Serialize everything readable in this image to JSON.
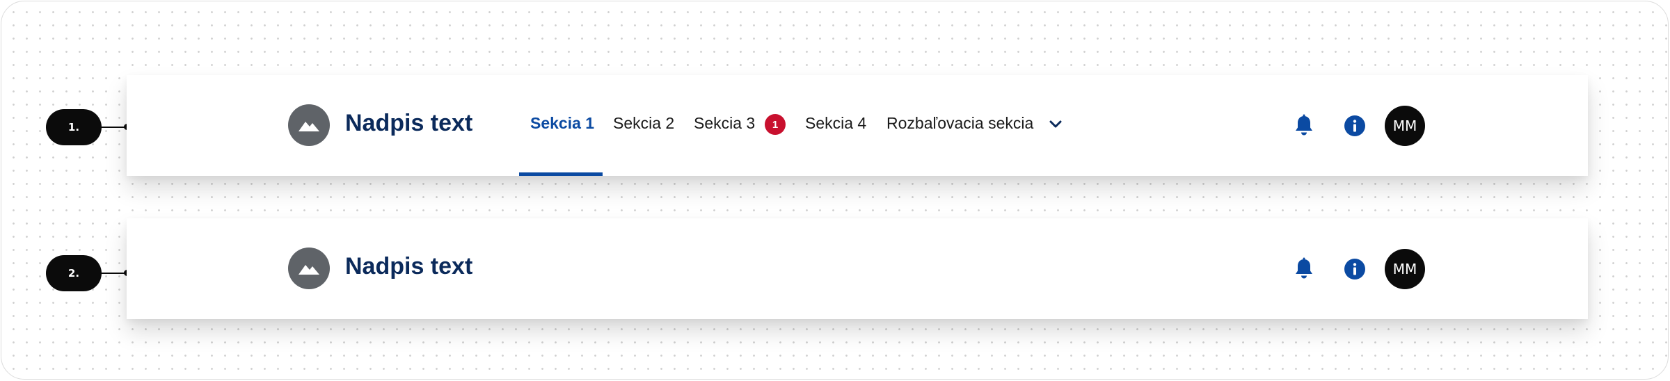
{
  "callouts": [
    "1.",
    "2."
  ],
  "header1": {
    "title": "Nadpis text",
    "logo_icon": "mountain-image-icon",
    "nav": [
      "Sekcia 1",
      "Sekcia 2",
      "Sekcia 3",
      "Sekcia 4",
      "Rozbaľovacia sekcia"
    ],
    "active_nav": "Sekcia 1",
    "badge_count": "1",
    "dropdown_icon": "chevron-down-icon",
    "notification_icon": "bell-icon",
    "info_icon": "info-icon",
    "avatar_initials": "MM"
  },
  "header2": {
    "title": "Nadpis text",
    "logo_icon": "mountain-image-icon",
    "notification_icon": "bell-icon",
    "info_icon": "info-icon",
    "avatar_initials": "MM"
  },
  "colors": {
    "brand_title": "#0b2a5b",
    "accent": "#0b4aa2",
    "badge": "#c8102e",
    "logo_bg": "#5f6368",
    "avatar_bg": "#0b0b0b"
  }
}
